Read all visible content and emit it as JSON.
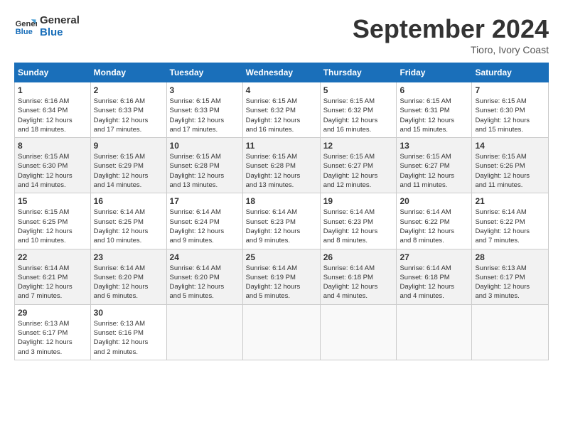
{
  "header": {
    "logo_line1": "General",
    "logo_line2": "Blue",
    "month_title": "September 2024",
    "location": "Tioro, Ivory Coast"
  },
  "days_of_week": [
    "Sunday",
    "Monday",
    "Tuesday",
    "Wednesday",
    "Thursday",
    "Friday",
    "Saturday"
  ],
  "weeks": [
    [
      {
        "day": "1",
        "sunrise": "6:16 AM",
        "sunset": "6:34 PM",
        "daylight": "12 hours and 18 minutes."
      },
      {
        "day": "2",
        "sunrise": "6:16 AM",
        "sunset": "6:33 PM",
        "daylight": "12 hours and 17 minutes."
      },
      {
        "day": "3",
        "sunrise": "6:15 AM",
        "sunset": "6:33 PM",
        "daylight": "12 hours and 17 minutes."
      },
      {
        "day": "4",
        "sunrise": "6:15 AM",
        "sunset": "6:32 PM",
        "daylight": "12 hours and 16 minutes."
      },
      {
        "day": "5",
        "sunrise": "6:15 AM",
        "sunset": "6:32 PM",
        "daylight": "12 hours and 16 minutes."
      },
      {
        "day": "6",
        "sunrise": "6:15 AM",
        "sunset": "6:31 PM",
        "daylight": "12 hours and 15 minutes."
      },
      {
        "day": "7",
        "sunrise": "6:15 AM",
        "sunset": "6:30 PM",
        "daylight": "12 hours and 15 minutes."
      }
    ],
    [
      {
        "day": "8",
        "sunrise": "6:15 AM",
        "sunset": "6:30 PM",
        "daylight": "12 hours and 14 minutes."
      },
      {
        "day": "9",
        "sunrise": "6:15 AM",
        "sunset": "6:29 PM",
        "daylight": "12 hours and 14 minutes."
      },
      {
        "day": "10",
        "sunrise": "6:15 AM",
        "sunset": "6:28 PM",
        "daylight": "12 hours and 13 minutes."
      },
      {
        "day": "11",
        "sunrise": "6:15 AM",
        "sunset": "6:28 PM",
        "daylight": "12 hours and 13 minutes."
      },
      {
        "day": "12",
        "sunrise": "6:15 AM",
        "sunset": "6:27 PM",
        "daylight": "12 hours and 12 minutes."
      },
      {
        "day": "13",
        "sunrise": "6:15 AM",
        "sunset": "6:27 PM",
        "daylight": "12 hours and 11 minutes."
      },
      {
        "day": "14",
        "sunrise": "6:15 AM",
        "sunset": "6:26 PM",
        "daylight": "12 hours and 11 minutes."
      }
    ],
    [
      {
        "day": "15",
        "sunrise": "6:15 AM",
        "sunset": "6:25 PM",
        "daylight": "12 hours and 10 minutes."
      },
      {
        "day": "16",
        "sunrise": "6:14 AM",
        "sunset": "6:25 PM",
        "daylight": "12 hours and 10 minutes."
      },
      {
        "day": "17",
        "sunrise": "6:14 AM",
        "sunset": "6:24 PM",
        "daylight": "12 hours and 9 minutes."
      },
      {
        "day": "18",
        "sunrise": "6:14 AM",
        "sunset": "6:23 PM",
        "daylight": "12 hours and 9 minutes."
      },
      {
        "day": "19",
        "sunrise": "6:14 AM",
        "sunset": "6:23 PM",
        "daylight": "12 hours and 8 minutes."
      },
      {
        "day": "20",
        "sunrise": "6:14 AM",
        "sunset": "6:22 PM",
        "daylight": "12 hours and 8 minutes."
      },
      {
        "day": "21",
        "sunrise": "6:14 AM",
        "sunset": "6:22 PM",
        "daylight": "12 hours and 7 minutes."
      }
    ],
    [
      {
        "day": "22",
        "sunrise": "6:14 AM",
        "sunset": "6:21 PM",
        "daylight": "12 hours and 7 minutes."
      },
      {
        "day": "23",
        "sunrise": "6:14 AM",
        "sunset": "6:20 PM",
        "daylight": "12 hours and 6 minutes."
      },
      {
        "day": "24",
        "sunrise": "6:14 AM",
        "sunset": "6:20 PM",
        "daylight": "12 hours and 5 minutes."
      },
      {
        "day": "25",
        "sunrise": "6:14 AM",
        "sunset": "6:19 PM",
        "daylight": "12 hours and 5 minutes."
      },
      {
        "day": "26",
        "sunrise": "6:14 AM",
        "sunset": "6:18 PM",
        "daylight": "12 hours and 4 minutes."
      },
      {
        "day": "27",
        "sunrise": "6:14 AM",
        "sunset": "6:18 PM",
        "daylight": "12 hours and 4 minutes."
      },
      {
        "day": "28",
        "sunrise": "6:13 AM",
        "sunset": "6:17 PM",
        "daylight": "12 hours and 3 minutes."
      }
    ],
    [
      {
        "day": "29",
        "sunrise": "6:13 AM",
        "sunset": "6:17 PM",
        "daylight": "12 hours and 3 minutes."
      },
      {
        "day": "30",
        "sunrise": "6:13 AM",
        "sunset": "6:16 PM",
        "daylight": "12 hours and 2 minutes."
      },
      null,
      null,
      null,
      null,
      null
    ]
  ]
}
